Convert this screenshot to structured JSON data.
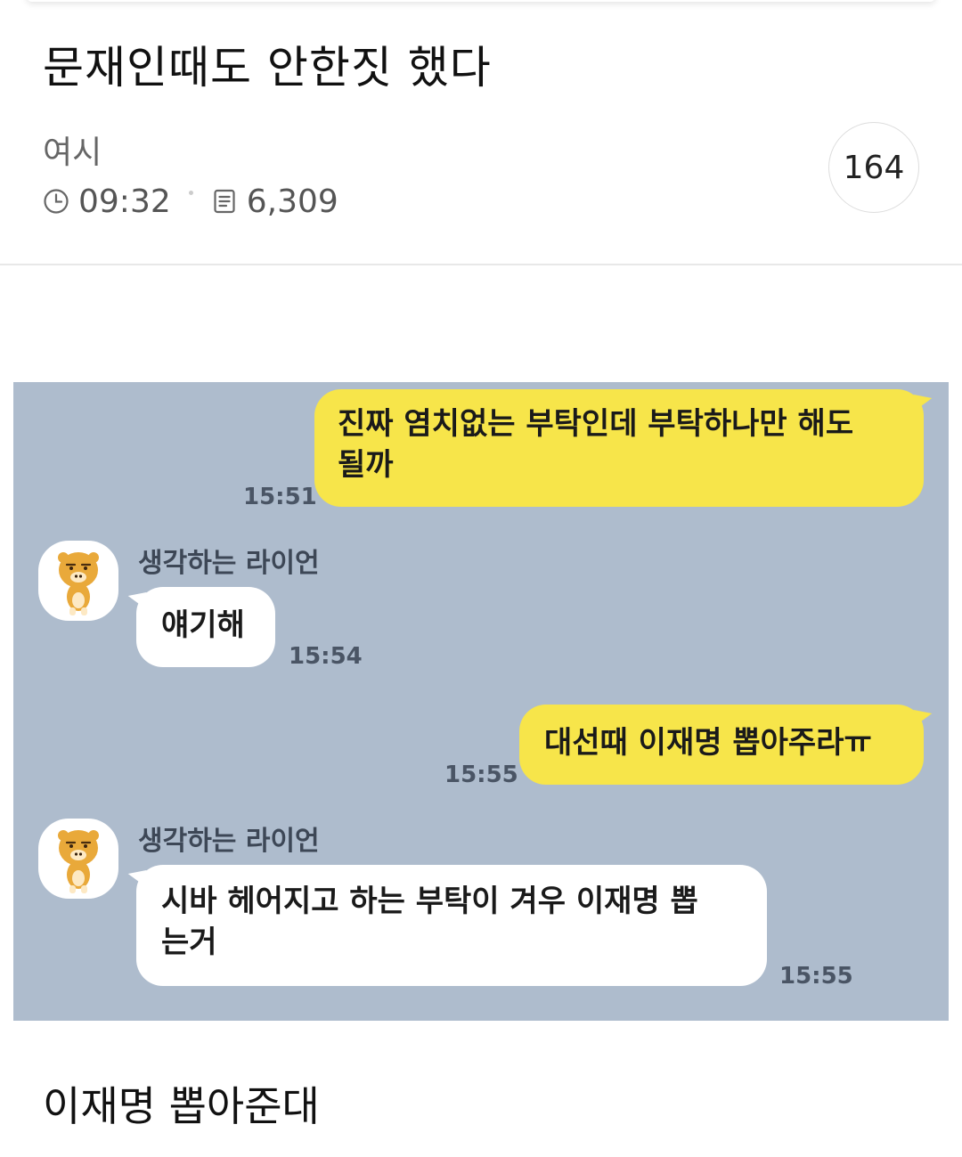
{
  "post": {
    "title": "문재인때도 안한짓 했다",
    "author": "여시",
    "time": "09:32",
    "views": "6,309",
    "comments": "164"
  },
  "chat": {
    "messages": [
      {
        "from": "me",
        "text_line1": "진짜 염치없는 부탁인데 부탁하나만 해도",
        "text_line2": "될까",
        "time": "15:51"
      },
      {
        "from": "them",
        "sender": "생각하는 라이언",
        "text": "얘기해",
        "time": "15:54"
      },
      {
        "from": "me",
        "text": "대선때 이재명 뽑아주라ㅠ",
        "time": "15:55"
      },
      {
        "from": "them",
        "sender": "생각하는 라이언",
        "text_line1": "시바 헤어지고 하는 부탁이 겨우 이재명 뽑",
        "text_line2": "는거",
        "time": "15:55"
      }
    ],
    "colors": {
      "background": "#aebccd",
      "my_bubble": "#f7e54a",
      "their_bubble": "#ffffff"
    },
    "avatar_icon": "ryan-character-icon"
  },
  "body_text": "이재명 뽑아준대",
  "icons": {
    "clock": "clock-icon",
    "views": "document-icon"
  }
}
